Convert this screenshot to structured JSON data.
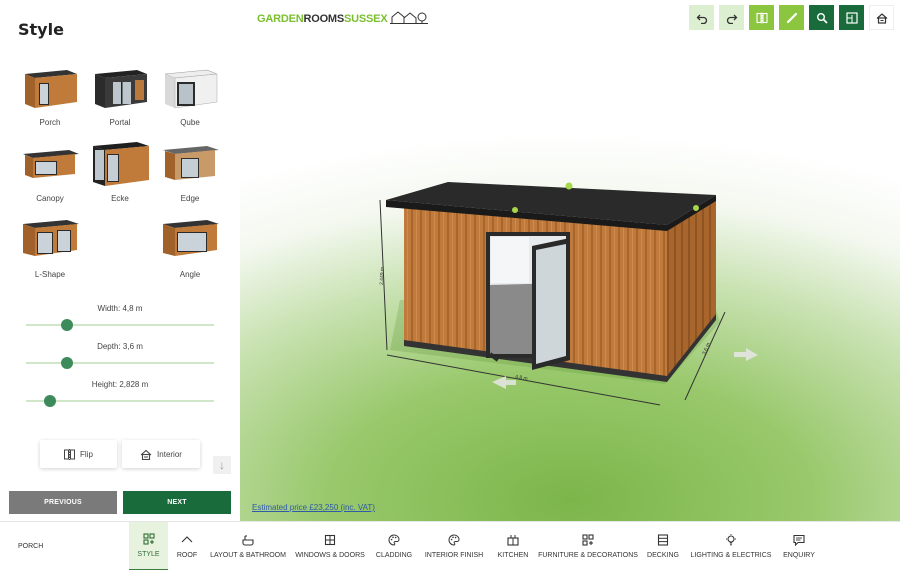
{
  "sidebar": {
    "title": "Style",
    "styles": [
      {
        "label": "Porch"
      },
      {
        "label": "Portal"
      },
      {
        "label": "Qube"
      },
      {
        "label": "Canopy"
      },
      {
        "label": "Ecke"
      },
      {
        "label": "Edge"
      },
      {
        "label": "L-Shape"
      },
      {
        "label": "Angle"
      }
    ],
    "dimensions": {
      "width": {
        "label": "Width:",
        "value": "4,8",
        "unit": "m",
        "fraction": 0.22
      },
      "depth": {
        "label": "Depth:",
        "value": "3,6",
        "unit": "m",
        "fraction": 0.22
      },
      "height": {
        "label": "Height:",
        "value": "2,828",
        "unit": "m",
        "fraction": 0.13
      }
    },
    "flip_label": "Flip",
    "interior_label": "Interior",
    "previous_label": "PREVIOUS",
    "next_label": "NEXT"
  },
  "viewport": {
    "logo": {
      "part1": "GARDEN",
      "part2": "ROOMS",
      "part3": "SUSSEX"
    },
    "toolbar_icons": [
      "undo-icon",
      "redo-icon",
      "flip-view-icon",
      "measure-icon",
      "zoom-icon",
      "floorplan-icon",
      "home-view-icon"
    ],
    "dimension_labels": {
      "height": "2,449 m",
      "width": "4,8 m",
      "depth": "3,6 m"
    },
    "price_text": "Estimated price £23,250 (inc. VAT)"
  },
  "bottom": {
    "current_step": "PORCH",
    "tabs": [
      {
        "label": "STYLE",
        "icon": "style-icon"
      },
      {
        "label": "ROOF",
        "icon": "roof-icon"
      },
      {
        "label": "LAYOUT & BATHROOM",
        "icon": "layout-icon"
      },
      {
        "label": "WINDOWS & DOORS",
        "icon": "window-icon"
      },
      {
        "label": "CLADDING",
        "icon": "palette-icon"
      },
      {
        "label": "INTERIOR FINISH",
        "icon": "palette-icon"
      },
      {
        "label": "KITCHEN",
        "icon": "kitchen-icon"
      },
      {
        "label": "FURNITURE & DECORATIONS",
        "icon": "furniture-icon"
      },
      {
        "label": "DECKING",
        "icon": "decking-icon"
      },
      {
        "label": "LIGHTING & ELECTRICS",
        "icon": "bulb-icon"
      },
      {
        "label": "ENQUIRY",
        "icon": "chat-icon"
      }
    ]
  },
  "colors": {
    "brand_green": "#7bbf2f",
    "brand_dark": "#333333",
    "dark_green": "#1a6b3c",
    "light_green": "#8cc63f",
    "slider_thumb": "#3d8b5a",
    "previous_gray": "#7a7a7a",
    "active_tab_bg": "#e8f3df"
  }
}
